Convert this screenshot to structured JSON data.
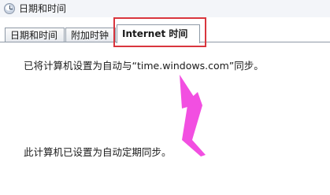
{
  "window": {
    "title": "日期和时间"
  },
  "tabs": [
    {
      "label": "日期和时间",
      "active": false
    },
    {
      "label": "附加时钟",
      "active": false
    },
    {
      "label": "Internet 时间",
      "active": true
    }
  ],
  "internet_time": {
    "sync_info": "已将计算机设置为自动与“time.windows.com”同步。",
    "auto_status": "此计算机已设置为自动定期同步。"
  },
  "annotation": {
    "highlight_color": "#d9363e",
    "arrow_color": "#f24fe1"
  }
}
